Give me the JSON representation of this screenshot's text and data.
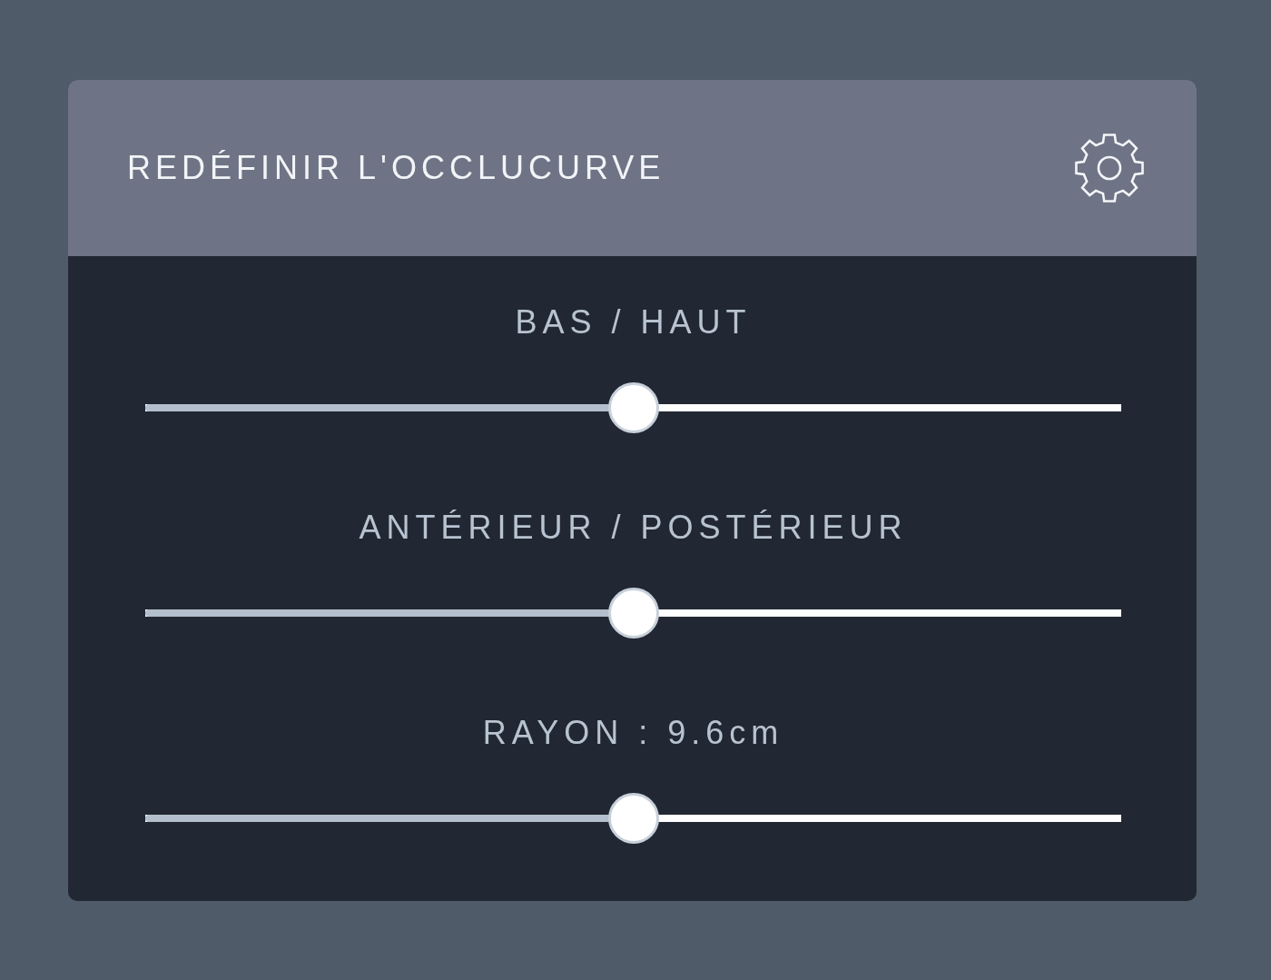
{
  "panel": {
    "title": "REDÉFINIR L'OCCLUCURVE"
  },
  "sliders": [
    {
      "label": "BAS / HAUT",
      "level": 0.5
    },
    {
      "label": "ANTÉRIEUR / POSTÉRIEUR",
      "level": 0.5
    },
    {
      "label": "RAYON : 9.6cm",
      "level": 0.5
    }
  ]
}
